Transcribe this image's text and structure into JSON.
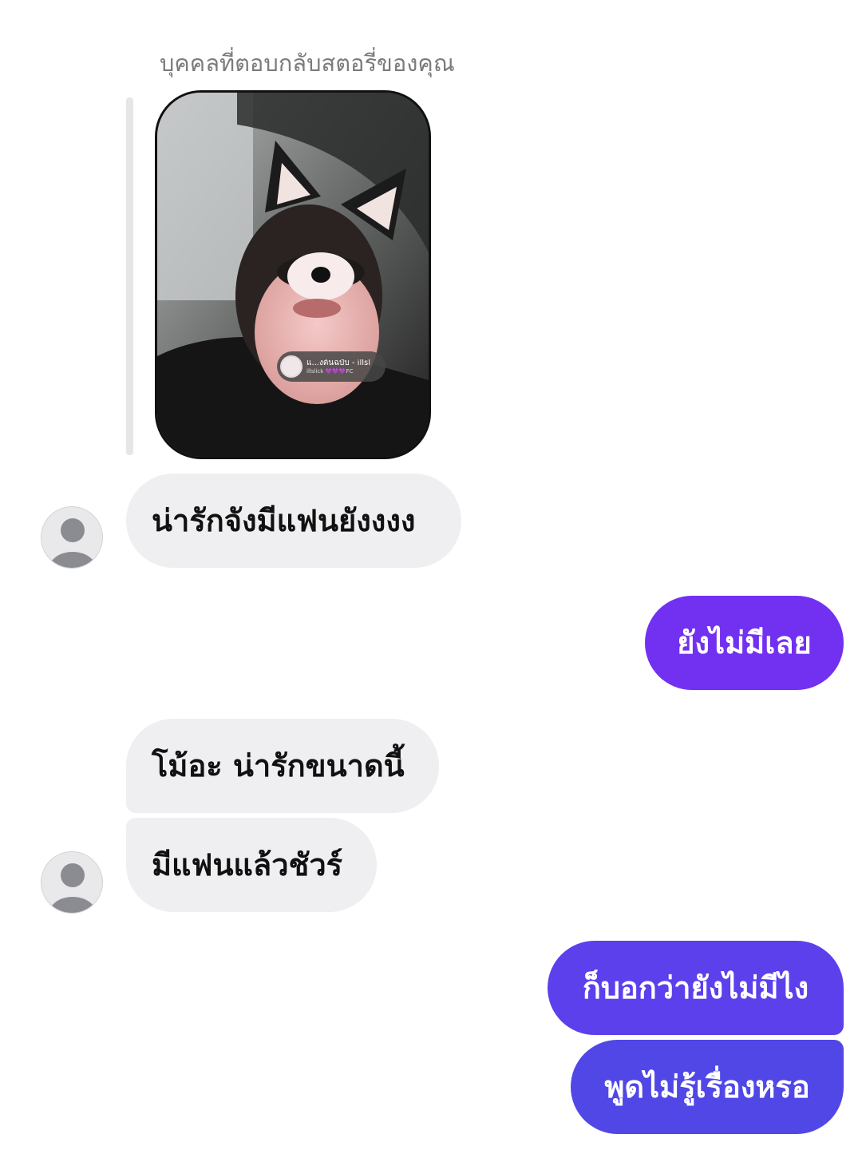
{
  "thread": {
    "story_reply_caption": "บุคคลที่ตอบกลับสตอรี่ของคุณ",
    "story": {
      "music_sticker_title": "แ...งต้นฉบับ - illsl",
      "music_sticker_artist": "illslick 💜💜💜FC"
    },
    "messages": [
      {
        "sender": "them",
        "text": "น่ารักจังมีแฟนยังงงง"
      },
      {
        "sender": "me",
        "text": "ยังไม่มีเลย"
      },
      {
        "sender": "them",
        "text": "โม้อะ น่ารักขนาดนี้"
      },
      {
        "sender": "them",
        "text": "มีแฟนแล้วชัวร์"
      },
      {
        "sender": "me",
        "text": "ก็บอกว่ายังไม่มีไง"
      },
      {
        "sender": "me",
        "text": "พูดไม่รู้เรื่องหรอ"
      }
    ]
  },
  "colors": {
    "incoming_bubble": "#efeff1",
    "outgoing_gradient_top": "#7a2ff0",
    "outgoing_gradient_bottom": "#5146e6",
    "caption_text": "#7b7b7b"
  },
  "icons": {
    "avatar": "default-user-silhouette-icon",
    "music_sticker": "music-disc-icon"
  }
}
